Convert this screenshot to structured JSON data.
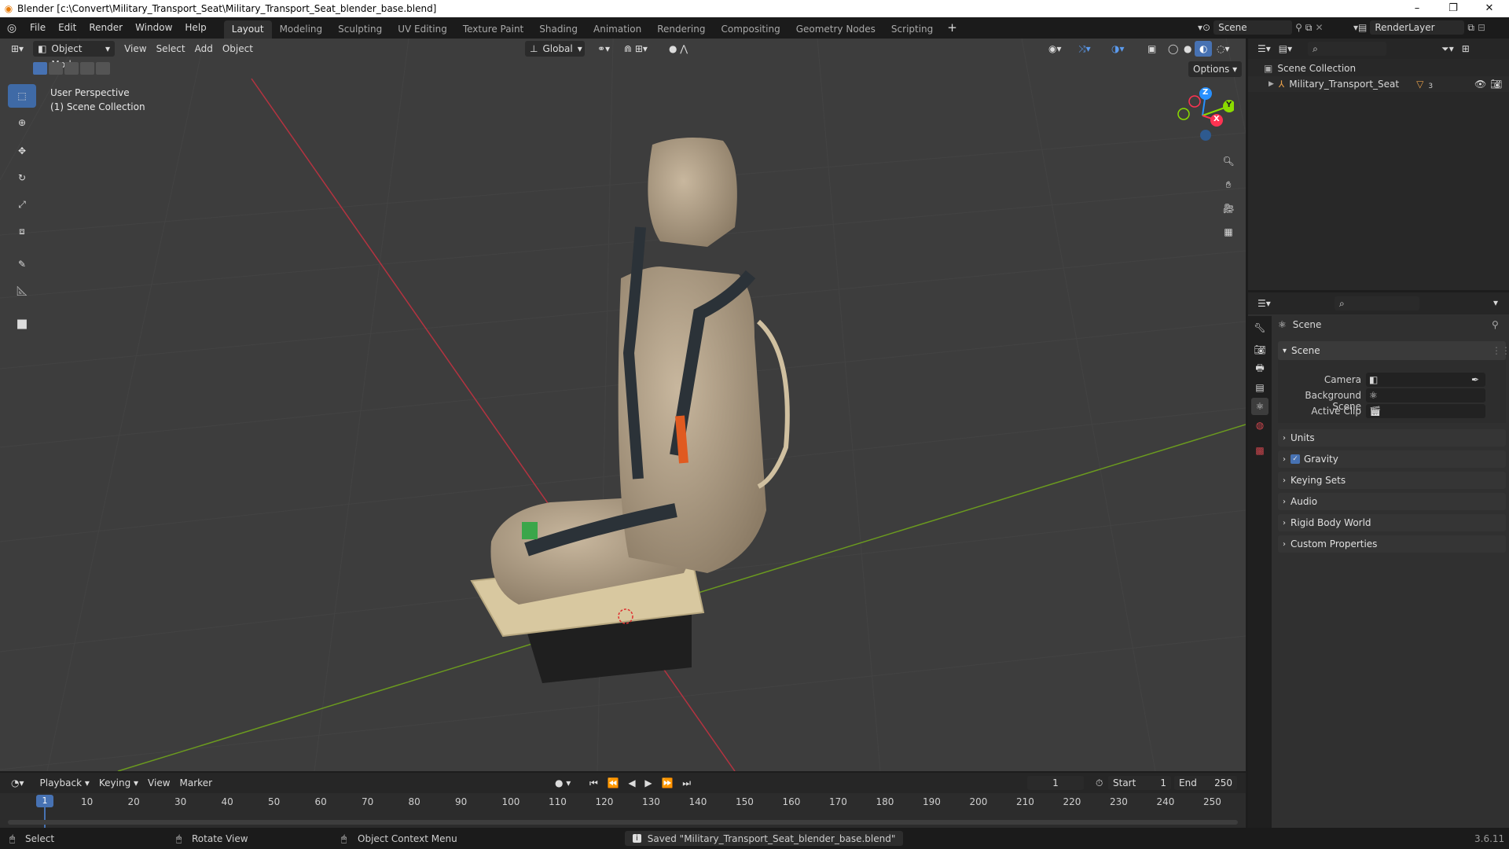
{
  "window": {
    "title": "Blender [c:\\Convert\\Military_Transport_Seat\\Military_Transport_Seat_blender_base.blend]",
    "controls": [
      "–",
      "❐",
      "✕"
    ]
  },
  "menubar": {
    "items": [
      "File",
      "Edit",
      "Render",
      "Window",
      "Help"
    ],
    "workspaces": [
      "Layout",
      "Modeling",
      "Sculpting",
      "UV Editing",
      "Texture Paint",
      "Shading",
      "Animation",
      "Rendering",
      "Compositing",
      "Geometry Nodes",
      "Scripting"
    ],
    "active_workspace": "Layout",
    "add_workspace": "+",
    "scene": "Scene",
    "view_layer": "RenderLayer"
  },
  "viewport": {
    "mode": "Object Mode",
    "menus": [
      "View",
      "Select",
      "Add",
      "Object"
    ],
    "transform_orientation": "Global",
    "options": "Options",
    "overlay_line1": "User Perspective",
    "overlay_line2": "(1) Scene Collection",
    "gizmo": {
      "z": "Z",
      "y": "Y",
      "x": "X"
    }
  },
  "outliner": {
    "collection": "Scene Collection",
    "object": "Military_Transport_Seat",
    "modifier_count": "3"
  },
  "properties": {
    "context": "Scene",
    "panel_title": "Scene",
    "camera_label": "Camera",
    "background_scene_label": "Background Scene",
    "active_clip_label": "Active Clip",
    "panels": [
      "Units",
      "Gravity",
      "Keying Sets",
      "Audio",
      "Rigid Body World",
      "Custom Properties"
    ],
    "gravity_checked": true
  },
  "timeline": {
    "menus": [
      "Playback",
      "Keying",
      "View",
      "Marker"
    ],
    "current_frame": "1",
    "start_label": "Start",
    "start": "1",
    "end_label": "End",
    "end": "250",
    "ticks": [
      "10",
      "20",
      "30",
      "40",
      "50",
      "60",
      "70",
      "80",
      "90",
      "100",
      "110",
      "120",
      "130",
      "140",
      "150",
      "160",
      "170",
      "180",
      "190",
      "200",
      "210",
      "220",
      "230",
      "240",
      "250"
    ],
    "playhead": "1"
  },
  "statusbar": {
    "select": "Select",
    "rotate": "Rotate View",
    "context_menu": "Object Context Menu",
    "message": "Saved \"Military_Transport_Seat_blender_base.blend\"",
    "version": "3.6.11"
  },
  "colors": {
    "accent": "#4772b3",
    "x_axis": "#ff3352",
    "y_axis": "#8bdc00",
    "z_axis": "#2890ff"
  }
}
